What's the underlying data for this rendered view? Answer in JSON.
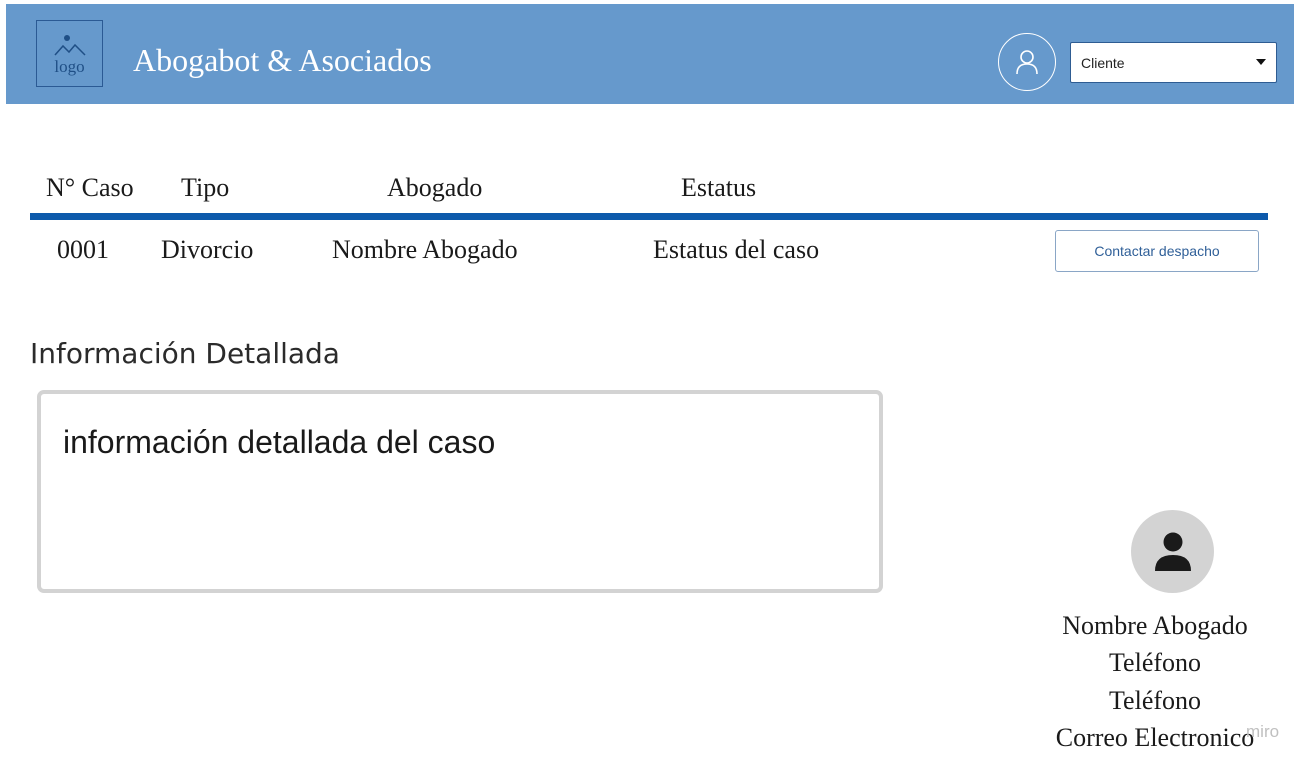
{
  "header": {
    "logo_text": "logo",
    "brand": "Abogabot & Asociados",
    "user_icon": "user-outline-icon",
    "role_select": {
      "value": "Cliente"
    },
    "background_color": "#6699cc"
  },
  "table": {
    "headers": [
      "N° Caso",
      "Tipo",
      "Abogado",
      "Estatus"
    ],
    "rows": [
      {
        "caso": "0001",
        "tipo": "Divorcio",
        "abogado": "Nombre Abogado",
        "estatus": "Estatus del caso",
        "action_label": "Contactar despacho"
      }
    ],
    "rule_color": "#0d5aab"
  },
  "detail": {
    "title": "Información Detallada",
    "text": "información detallada del caso"
  },
  "lawyer_card": {
    "avatar_icon": "person-icon",
    "name": "Nombre Abogado",
    "phone_1": "Teléfono",
    "phone_2": "Teléfono",
    "email": "Correo Electronico"
  },
  "watermark": "miro"
}
